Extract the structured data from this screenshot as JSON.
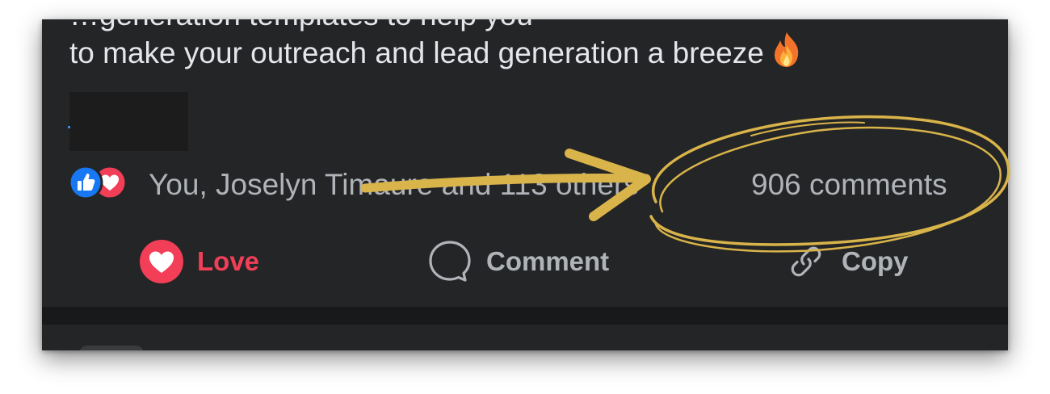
{
  "post": {
    "partial_line": "…generation templates to help you",
    "text": "to make your outreach and lead generation a breeze",
    "emoji": "fire-emoji"
  },
  "reactions": {
    "icons": [
      "like-icon",
      "love-icon"
    ],
    "names": "You, Joselyn Timaure and 113 others",
    "comments": "906 comments"
  },
  "actions": {
    "love_label": "Love",
    "comment_label": "Comment",
    "copy_label": "Copy"
  },
  "colors": {
    "card_bg": "#242526",
    "text_primary": "#e4e6eb",
    "text_secondary": "#b0b3b8",
    "love_red": "#f33e58",
    "like_blue": "#1877f2",
    "annotation_gold": "#d9b44a"
  }
}
